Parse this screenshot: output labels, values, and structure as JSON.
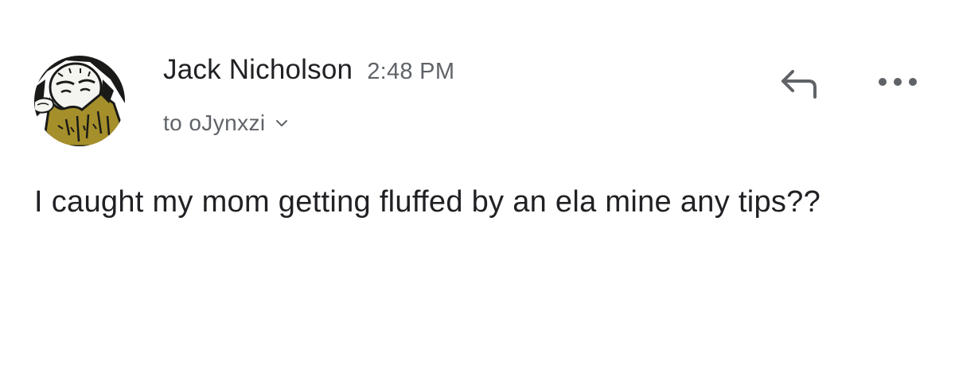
{
  "email": {
    "sender_name": "Jack Nicholson",
    "sent_time": "2:48 PM",
    "recipient_line": "to oJynxzi",
    "body_text": "I caught my mom getting fluffed by an ela mine any tips??"
  },
  "icons": {
    "avatar": "sender-avatar-illustration",
    "recipient_toggle": "chevron-down-icon",
    "reply": "reply-arrow-icon",
    "more": "more-horizontal-icon"
  },
  "colors": {
    "text_primary": "#202124",
    "text_secondary": "#5f6368",
    "icon": "#5f6368",
    "avatar_beard": "#a58f2a",
    "background": "#ffffff"
  }
}
